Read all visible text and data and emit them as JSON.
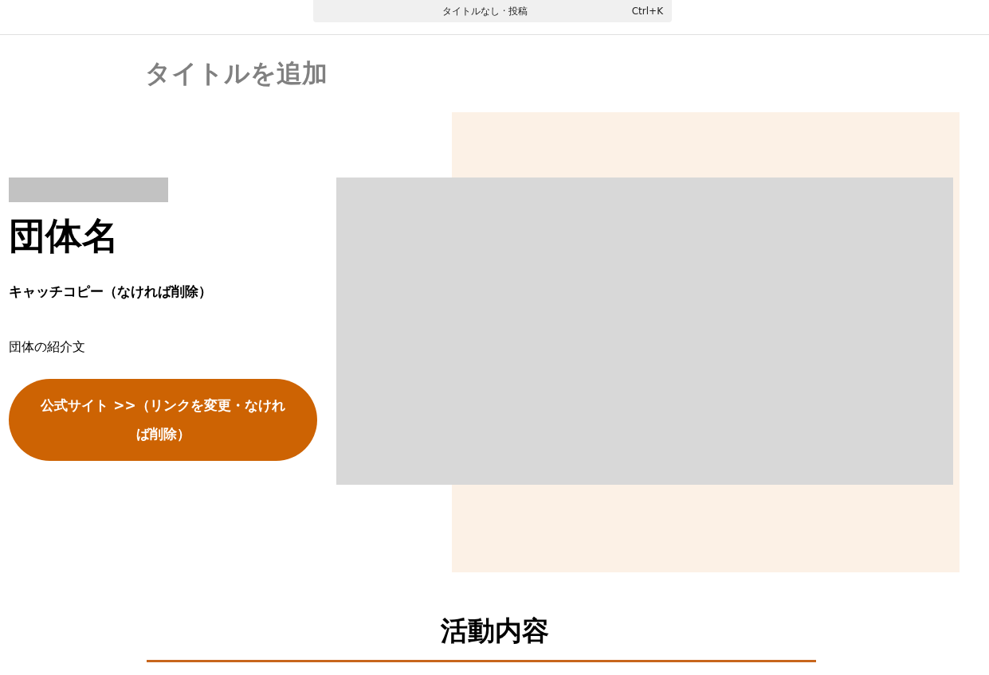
{
  "command_bar": {
    "document_title": "タイトルなし · 投稿",
    "shortcut": "Ctrl+K"
  },
  "editor": {
    "title": {
      "placeholder": "タイトルを追加"
    }
  },
  "hero": {
    "org_name": "団体名",
    "catch_copy": "キャッチコピー（なければ削除）",
    "intro": "団体の紹介文",
    "button_label": "公式サイト >>（リンクを変更・なければ削除）"
  },
  "section": {
    "heading": "活動内容"
  }
}
